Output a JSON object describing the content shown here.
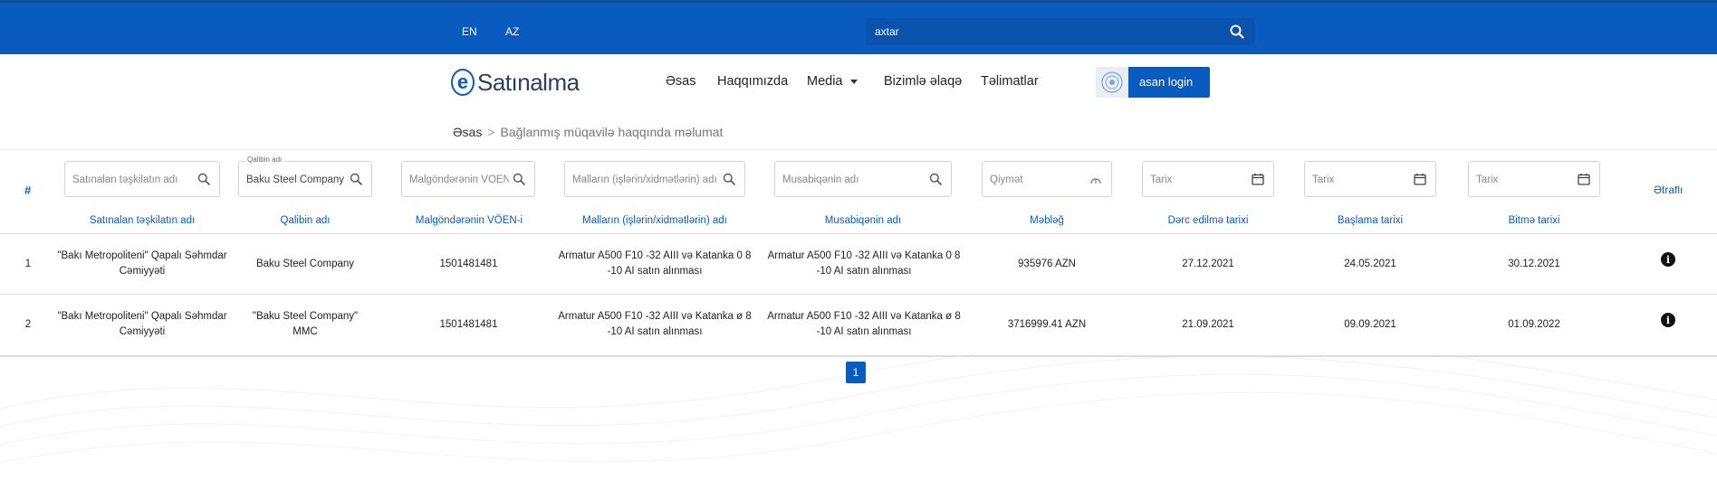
{
  "topbar": {
    "lang_en": "EN",
    "lang_az": "AZ",
    "search_placeholder": "axtar",
    "bg_color": "#0a5bbf"
  },
  "header": {
    "logo_text": "Satınalma",
    "logo_mark": "e",
    "nav": [
      "Əsas",
      "Haqqımızda",
      "Media",
      "Bizimlə əlaqə",
      "Təlimatlar"
    ],
    "asan_login": "asan login"
  },
  "breadcrumb": {
    "home": "Əsas",
    "separator": ">",
    "current": "Bağlanmış müqavilə haqqında məlumat"
  },
  "filters": {
    "hash": "#",
    "org_placeholder": "Satınalan təşkilatın adı",
    "winner_label": "Qalibin adı",
    "winner_value": "Baku Steel Company",
    "voen_placeholder": "Malgöndərənin VÖEN-i",
    "goods_placeholder": "Malların (işlərin/xidmətlərin) adı",
    "competitor_placeholder": "Musabiqənin adı",
    "price_placeholder": "Qiymət",
    "date1_placeholder": "Tarix",
    "date2_placeholder": "Tarix",
    "date3_placeholder": "Tarix",
    "details_header": "Ətraflı"
  },
  "table": {
    "headers": [
      "Satınalan təşkilatın adı",
      "Qalibin adı",
      "Malgöndərənin VÖEN-i",
      "Malların (işlərin/xidmətlərin) adı",
      "Musabiqənin adı",
      "Məbləğ",
      "Dərc edilmə tarixi",
      "Başlama tarixi",
      "Bitmə tarixi"
    ],
    "rows": [
      {
        "num": "1",
        "org": "\"Bakı Metropoliteni\" Qapalı Səhmdar Cəmiyyəti",
        "winner": "Baku Steel Company",
        "voen": "1501481481",
        "goods": "Armatur A500 F10 -32 AIII və Katanka 0 8 -10 AI satın alınması",
        "competition": "Armatur A500 F10 -32 AIII və Katanka 0 8 -10 AI satın alınması",
        "amount": "935976 AZN",
        "published": "27.12.2021",
        "start": "24.05.2021",
        "end": "30.12.2021"
      },
      {
        "num": "2",
        "org": "\"Bakı Metropoliteni\" Qapalı Səhmdar Cəmiyyəti",
        "winner": "\"Baku Steel Company\" MMC",
        "voen": "1501481481",
        "goods": "Armatur A500 F10 -32 AIII və Katanka ø 8 -10 AI satın alınması",
        "competition": "Armatur A500 F10 -32 AIII və Katanka ø 8 -10 AI satın alınması",
        "amount": "3716999.41 AZN",
        "published": "21.09.2021",
        "start": "09.09.2021",
        "end": "01.09.2022"
      }
    ]
  },
  "pagination": {
    "current_page": "1"
  },
  "icons": {
    "search": "search-icon",
    "calendar": "calendar-icon",
    "info": "info-icon",
    "caret": "chevron-down-icon"
  }
}
